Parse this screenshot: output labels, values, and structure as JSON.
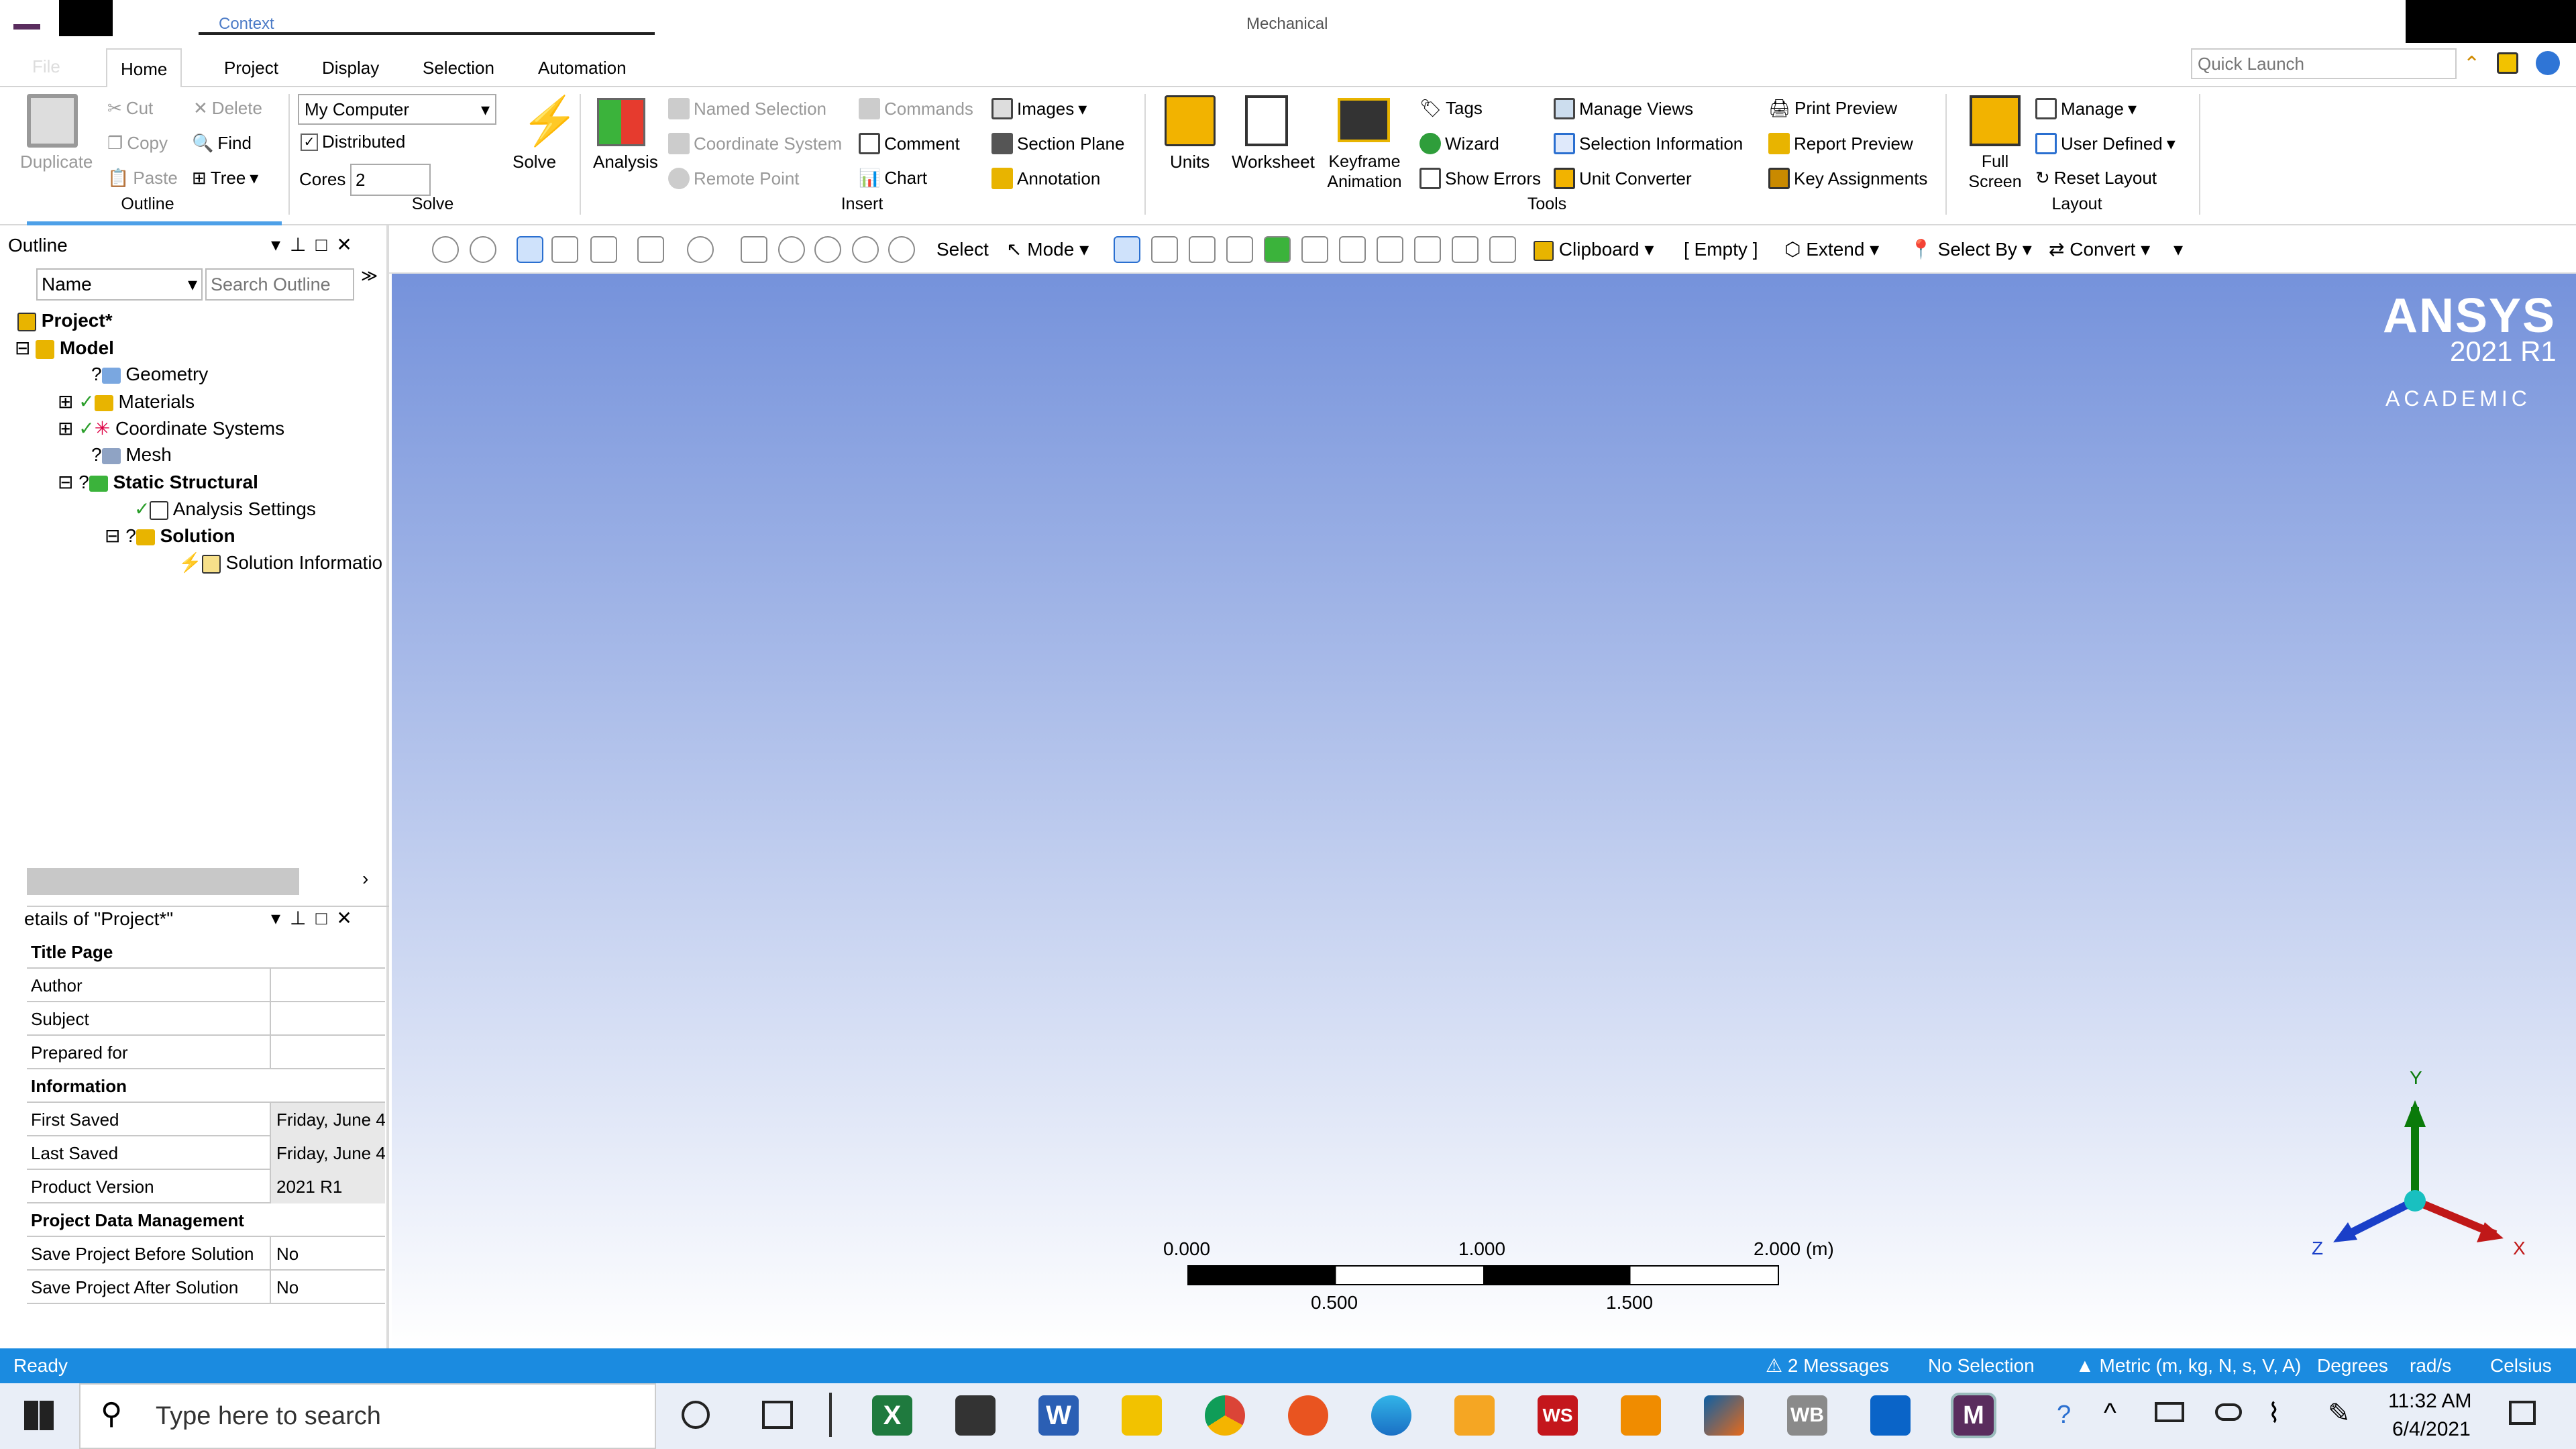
{
  "window": {
    "title": "Mechanical",
    "context_label": "Context",
    "file_label": "File"
  },
  "ribbon_tabs": [
    "Home",
    "Project",
    "Display",
    "Selection",
    "Automation"
  ],
  "quick_launch_placeholder": "Quick Launch",
  "ribbon": {
    "outline": {
      "group": "Outline",
      "duplicate": "Duplicate",
      "cut": "Cut",
      "copy": "Copy",
      "paste": "Paste",
      "delete": "Delete",
      "find": "Find",
      "tree": "Tree"
    },
    "solve": {
      "group": "Solve",
      "solver": "My Computer",
      "distributed": "Distributed",
      "cores_label": "Cores",
      "cores_value": "2",
      "solve_label": "Solve"
    },
    "insert": {
      "group": "Insert",
      "analysis": "Analysis",
      "named_selection": "Named Selection",
      "coordinate_system": "Coordinate System",
      "remote_point": "Remote Point",
      "commands": "Commands",
      "comment": "Comment",
      "chart": "Chart",
      "images": "Images",
      "section_plane": "Section Plane",
      "annotation": "Annotation"
    },
    "tools": {
      "group": "Tools",
      "units": "Units",
      "worksheet": "Worksheet",
      "keyframe_1": "Keyframe",
      "keyframe_2": "Animation",
      "tags": "Tags",
      "wizard": "Wizard",
      "show_errors": "Show Errors",
      "manage_views": "Manage Views",
      "selection_information": "Selection Information",
      "unit_converter": "Unit Converter",
      "print_preview": "Print Preview",
      "report_preview": "Report Preview",
      "key_assignments": "Key Assignments"
    },
    "layout": {
      "group": "Layout",
      "full_1": "Full",
      "full_2": "Screen",
      "manage": "Manage",
      "user_defined": "User Defined",
      "reset_layout": "Reset Layout"
    }
  },
  "toolbar": {
    "select": "Select",
    "mode": "Mode",
    "clipboard": "Clipboard",
    "empty": "[ Empty ]",
    "extend": "Extend",
    "select_by": "Select By",
    "convert": "Convert"
  },
  "outline_panel": {
    "title": "Outline",
    "name_filter": "Name",
    "search_placeholder": "Search Outline",
    "tree": [
      "Project*",
      "Model",
      "Geometry",
      "Materials",
      "Coordinate Systems",
      "Mesh",
      "Static Structural",
      "Analysis Settings",
      "Solution",
      "Solution Informatio"
    ]
  },
  "details": {
    "title": "etails of \"Project*\"",
    "rows": [
      {
        "k": "Title Page",
        "v": "",
        "h": true
      },
      {
        "k": "Author",
        "v": ""
      },
      {
        "k": "Subject",
        "v": ""
      },
      {
        "k": "Prepared for",
        "v": ""
      },
      {
        "k": "Information",
        "v": "",
        "h": true
      },
      {
        "k": "First Saved",
        "v": "Friday, June 4..."
      },
      {
        "k": "Last Saved",
        "v": "Friday, June 4..."
      },
      {
        "k": "Product Version",
        "v": "2021 R1"
      },
      {
        "k": "Project Data Management",
        "v": "",
        "h": true
      },
      {
        "k": "Save Project Before Solution",
        "v": "No"
      },
      {
        "k": "Save Project After Solution",
        "v": "No"
      }
    ]
  },
  "viewport": {
    "logo_1": "ANSYS",
    "logo_2": "2021 R1",
    "logo_3": "ACADEMIC",
    "scale": {
      "l0": "0.000",
      "l1": "1.000",
      "l2": "2.000 (m)",
      "l3": "0.500",
      "l4": "1.500"
    },
    "axes": {
      "x": "X",
      "y": "Y",
      "z": "Z"
    }
  },
  "status": {
    "ready": "Ready",
    "messages": "2 Messages",
    "selection": "No Selection",
    "units": "Metric (m, kg, N, s, V, A)",
    "degrees": "Degrees",
    "rads": "rad/s",
    "celsius": "Celsius"
  },
  "taskbar": {
    "search_placeholder": "Type here to search",
    "time": "11:32 AM",
    "date": "6/4/2021",
    "ws_badge": "WS",
    "word_badge": "W",
    "excel_badge": "X",
    "wb_badge": "WB",
    "m_badge": "M"
  },
  "colors": {
    "accent": "#1b8be0",
    "viewport_top": "#7592db"
  }
}
